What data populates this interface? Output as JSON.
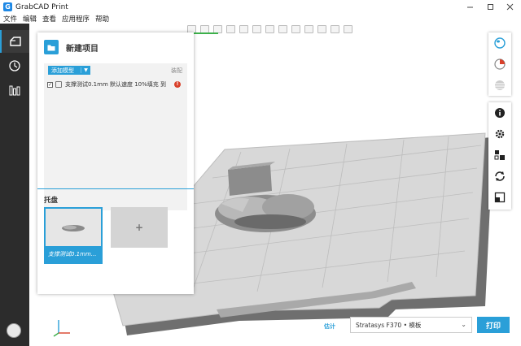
{
  "window": {
    "title": "GrabCAD Print",
    "app_icon": "G"
  },
  "menu": [
    "文件",
    "编辑",
    "查看",
    "应用程序",
    "帮助"
  ],
  "panel": {
    "title": "新建项目",
    "add_model_label": "添加模型",
    "assemble_label": "装配",
    "model": {
      "checked": "✓",
      "name": "支撑测试0.1mm 默认速度 10%填充 到",
      "warning": "!"
    },
    "tray_label": "托盘",
    "tray_card_caption": "支撑测试0.1mm...",
    "tray_add_label": "+"
  },
  "bottom": {
    "estimate_label": "估计",
    "printer": "Stratasys F370 • 模板",
    "print_label": "打印"
  },
  "colors": {
    "accent": "#2a9fd8",
    "progress": "#3cb04a",
    "warning": "#d9412b"
  }
}
